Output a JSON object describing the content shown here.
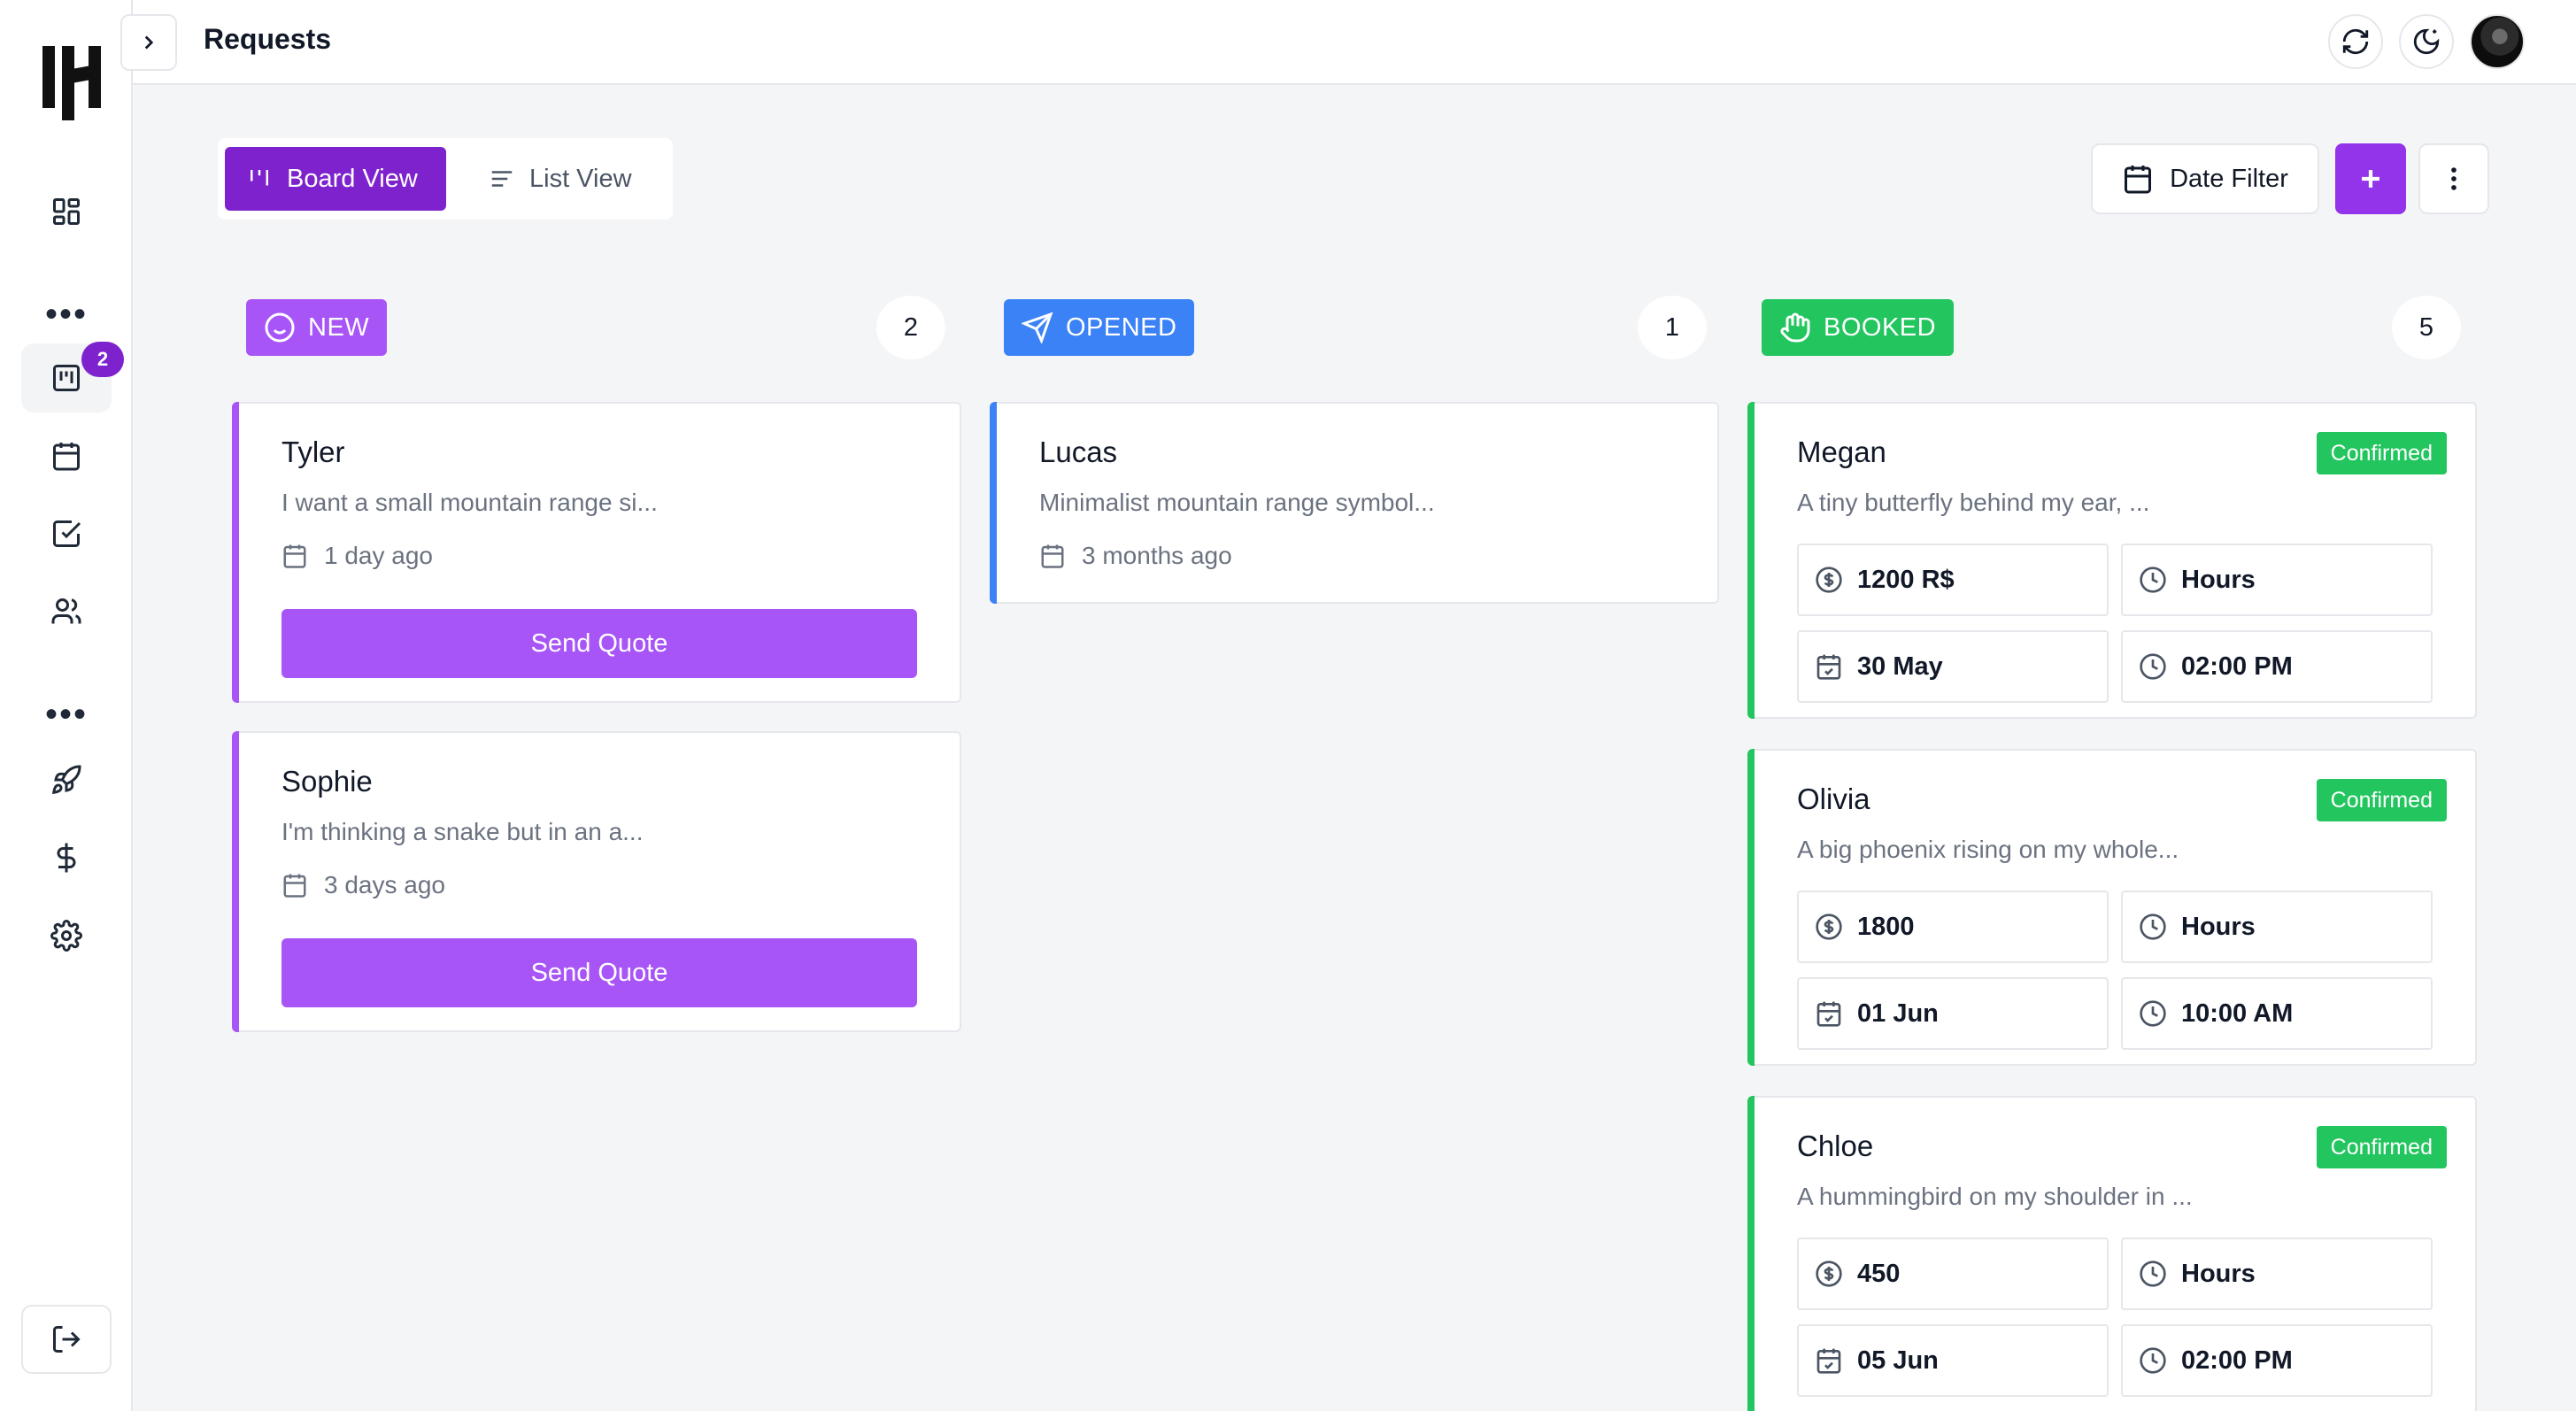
{
  "header": {
    "title": "Requests"
  },
  "sidebar": {
    "badge_count": "2"
  },
  "views": {
    "board_label": "Board View",
    "list_label": "List View"
  },
  "actions": {
    "date_filter_label": "Date Filter"
  },
  "colors": {
    "purple": "#7e22ce",
    "new": "#a855f7",
    "opened": "#3b82f6",
    "booked": "#22c55e"
  },
  "columns": [
    {
      "label": "NEW",
      "count": "2",
      "icon": "smile-icon",
      "cards": [
        {
          "name": "Tyler",
          "description": "I want a small mountain range si...",
          "date": "1 day ago",
          "button": "Send Quote"
        },
        {
          "name": "Sophie",
          "description": "I'm thinking a snake but in an a...",
          "date": "3 days ago",
          "button": "Send Quote"
        }
      ]
    },
    {
      "label": "OPENED",
      "count": "1",
      "icon": "send-icon",
      "cards": [
        {
          "name": "Lucas",
          "description": "Minimalist mountain range symbol...",
          "date": "3 months ago"
        }
      ]
    },
    {
      "label": "BOOKED",
      "count": "5",
      "icon": "hand-icon",
      "cards": [
        {
          "name": "Megan",
          "status": "Confirmed",
          "description": "A tiny butterfly behind my ear, ...",
          "price": "1200 R$",
          "duration": "Hours",
          "date": "30 May",
          "time": "02:00 PM"
        },
        {
          "name": "Olivia",
          "status": "Confirmed",
          "description": "A big phoenix rising on my whole...",
          "price": "1800",
          "duration": "Hours",
          "date": "01 Jun",
          "time": "10:00 AM"
        },
        {
          "name": "Chloe",
          "status": "Confirmed",
          "description": "A hummingbird on my shoulder in ...",
          "price": "450",
          "duration": "Hours",
          "date": "05 Jun",
          "time": "02:00 PM"
        }
      ]
    }
  ]
}
